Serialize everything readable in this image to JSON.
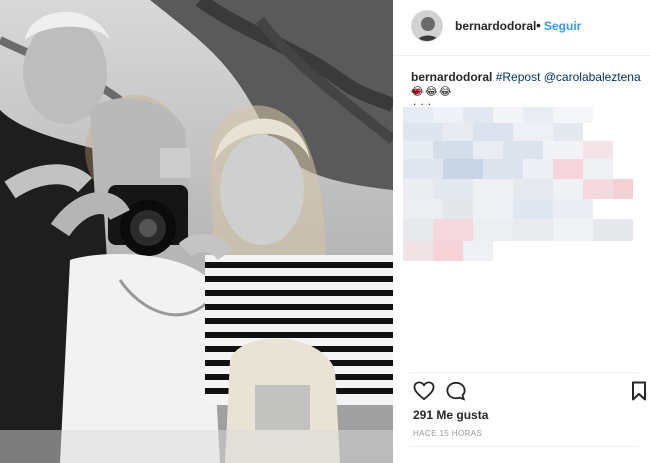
{
  "post": {
    "username": "bernardodoral",
    "separator": "•",
    "follow_label": "Seguir",
    "caption": {
      "username": "bernardodoral",
      "hashtag": "#Repost",
      "mention": "@carolabaleztena",
      "emojis": "😂😂😂",
      "ellipsis": "..."
    },
    "likes": "291 Me gusta",
    "time": "HACE 15 HORAS"
  },
  "icons": {
    "like": "heart-outline-icon",
    "comment": "comment-bubble-icon",
    "save": "bookmark-icon",
    "heart_emoji": "red-heart-icon"
  },
  "colors": {
    "link": "#003569",
    "follow": "#3897f0",
    "heart": "#ed1f24",
    "muted": "#999999"
  }
}
